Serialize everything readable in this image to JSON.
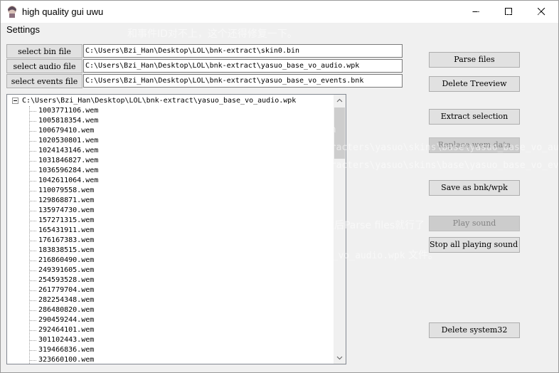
{
  "window": {
    "title": "high quality gui uwu",
    "icon": "anime-avatar-icon",
    "minimize_icon": "minimize-icon",
    "maximize_icon": "maximize-icon",
    "close_icon": "close-icon"
  },
  "menu": {
    "settings_label": "Settings"
  },
  "file_selectors": {
    "bin_label": "select bin file",
    "audio_label": "select audio file",
    "events_label": "select events file",
    "bin_path": "C:\\Users\\Bzi_Han\\Desktop\\LOL\\bnk-extract\\skin0.bin",
    "audio_path": "C:\\Users\\Bzi_Han\\Desktop\\LOL\\bnk-extract\\yasuo_base_vo_audio.wpk",
    "events_path": "C:\\Users\\Bzi_Han\\Desktop\\LOL\\bnk-extract\\yasuo_base_vo_events.bnk"
  },
  "tree": {
    "root": "C:\\Users\\Bzi_Han\\Desktop\\LOL\\bnk-extract\\yasuo_base_vo_audio.wpk",
    "items": [
      "1003771106.wem",
      "1005818354.wem",
      "100679410.wem",
      "1020530801.wem",
      "1024143146.wem",
      "1031846827.wem",
      "1036596284.wem",
      "1042611064.wem",
      "110079558.wem",
      "129868871.wem",
      "135974730.wem",
      "157271315.wem",
      "165431911.wem",
      "176167383.wem",
      "183838515.wem",
      "216860490.wem",
      "249391605.wem",
      "254593528.wem",
      "261779704.wem",
      "282254348.wem",
      "286480820.wem",
      "290459244.wem",
      "292464101.wem",
      "301102443.wem",
      "319466836.wem",
      "323660100.wem"
    ]
  },
  "actions": {
    "parse": "Parse files",
    "delete_treeview": "Delete Treeview",
    "extract": "Extract selection",
    "replace": "Replace wem data",
    "save": "Save as bnk/wpk",
    "play": "Play sound",
    "stop": "Stop all playing sound",
    "delete_system": "Delete system32"
  },
  "overlay": {
    "line1": "可以看到我们的模型和动画都已经正常了，不过又发现人物的音效没有了，估计是 wwise 的版本",
    "line2": "和事件ID对不上，这个还得修复一下。",
    "code1": "data\\characters\\yasuo\\skins\\skin0.bin",
    "code2": "assets\\sounds\\wwise2016\\vo\\en_us\\characters\\yasuo\\skins\\base\\yasuo_base_vo_audio.wpk",
    "code3": "assets\\sounds\\wwise2016\\vo\\en_us\\characters\\yasuo\\skins\\base\\yasuo_base_vo_events.bnk",
    "line3": "都给复制出来",
    "line4_pre": "然后用 ",
    "line4_code": "bnk-gui.exe",
    "line4_post": " 依次打开上面的文件，然后Parse files就行了",
    "line5_pre": "再用同样的步骤Parse妖梦亚索的 ",
    "line5_code": "yasuo_base_vo_audio.wpk",
    "line5_post": " 文件。"
  }
}
